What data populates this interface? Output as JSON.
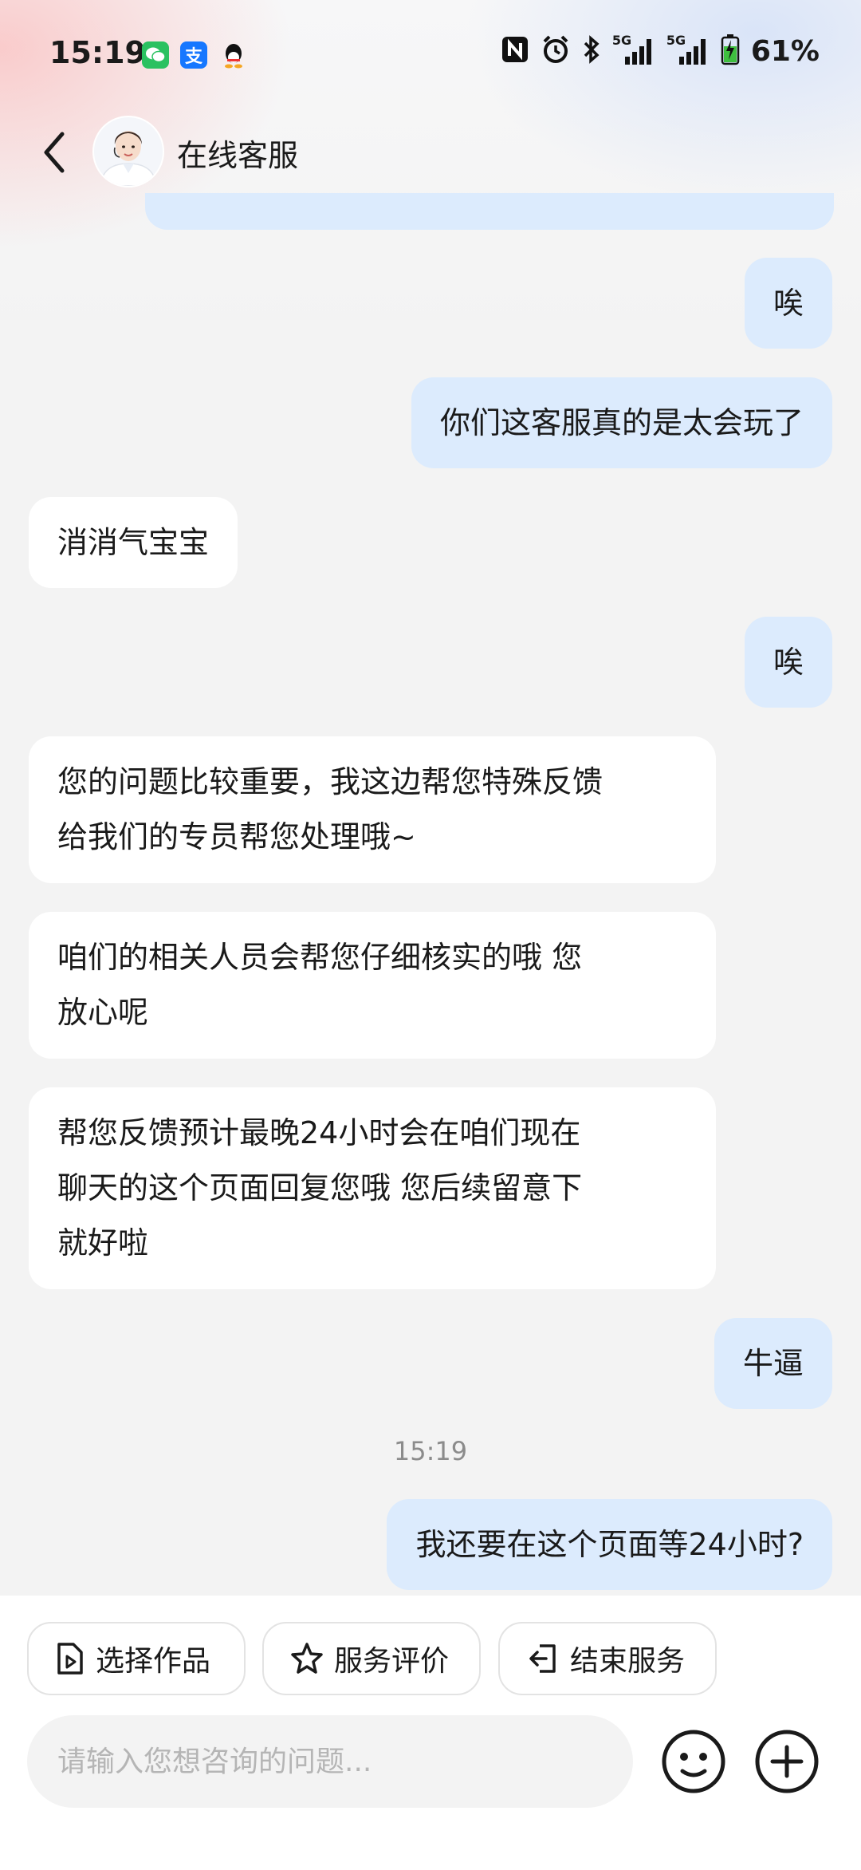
{
  "status_bar": {
    "time": "15:19",
    "signal1": "5G",
    "signal2": "5G",
    "battery": "61%"
  },
  "header": {
    "title": "在线客服"
  },
  "messages": [
    {
      "role": "user",
      "text": "唉"
    },
    {
      "role": "user",
      "text": "你们这客服真的是太会玩了"
    },
    {
      "role": "agent",
      "text": "消消气宝宝"
    },
    {
      "role": "user",
      "text": "唉"
    },
    {
      "role": "agent",
      "text": "您的问题比较重要，我这边帮您特殊反馈\n给我们的专员帮您处理哦~"
    },
    {
      "role": "agent",
      "text": "咱们的相关人员会帮您仔细核实的哦 您\n放心呢"
    },
    {
      "role": "agent",
      "text": "帮您反馈预计最晚24小时会在咱们现在\n聊天的这个页面回复您哦 您后续留意下\n就好啦"
    },
    {
      "role": "user",
      "text": "牛逼"
    },
    {
      "role": "user",
      "text": "我还要在这个页面等24小时?"
    }
  ],
  "timestamp": "15:19",
  "quick_actions": [
    {
      "label": "选择作品",
      "icon": "file-play-icon"
    },
    {
      "label": "服务评价",
      "icon": "star-icon"
    },
    {
      "label": "结束服务",
      "icon": "exit-icon"
    }
  ],
  "input": {
    "placeholder": "请输入您想咨询的问题..."
  },
  "colors": {
    "user_bubble": "#dcebfd",
    "agent_bubble": "#ffffff",
    "background": "#f3f3f3"
  }
}
